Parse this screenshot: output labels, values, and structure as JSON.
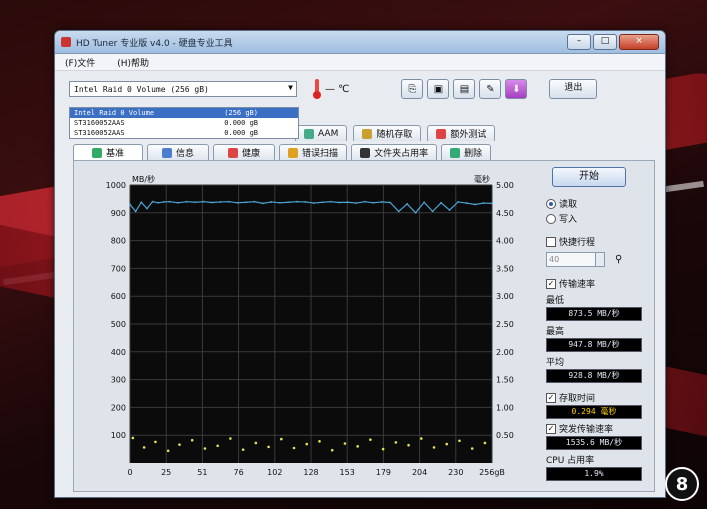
{
  "window": {
    "title": "HD Tuner 专业版 v4.0 - 硬盘专业工具",
    "minimize": "–",
    "maximize": "□",
    "close": "×"
  },
  "menu": {
    "file": "(F)文件",
    "help": "(H)帮助"
  },
  "toolbar": {
    "drive_selected": "Intel  Raid 0 Volume (256 gB)",
    "temp_reading": "— ℃",
    "exit_label": "退出"
  },
  "dropdown": {
    "options": [
      {
        "name": "Intel  Raid 0 Volume",
        "capacity": "(256 gB)"
      },
      {
        "name": "ST3160052AAS",
        "capacity": "0.000 gB"
      },
      {
        "name": "ST3160052AAS",
        "capacity": "0.000 gB"
      }
    ]
  },
  "tabs_upper": [
    {
      "label": "AAM",
      "icon": "speaker-icon"
    },
    {
      "label": "随机存取",
      "icon": "random-access-icon"
    },
    {
      "label": "额外测试",
      "icon": "extra-test-icon"
    }
  ],
  "tabs_lower": [
    {
      "label": "基准",
      "icon": "benchmark-icon"
    },
    {
      "label": "信息",
      "icon": "info-icon"
    },
    {
      "label": "健康",
      "icon": "health-icon"
    },
    {
      "label": "错误扫描",
      "icon": "error-scan-icon"
    },
    {
      "label": "文件夹占用率",
      "icon": "folder-usage-icon"
    },
    {
      "label": "删除",
      "icon": "erase-icon"
    }
  ],
  "panel": {
    "start": "开始",
    "read": "读取",
    "write": "写入",
    "shortstroke": "快捷行程",
    "shortstroke_value": "40",
    "transfer_rate": "传输速率",
    "min_label": "最低",
    "min_value": "873.5 MB/秒",
    "max_label": "最高",
    "max_value": "947.8 MB/秒",
    "avg_label": "平均",
    "avg_value": "928.8 MB/秒",
    "access_time": "存取时间",
    "access_value": "0.294 毫秒",
    "burst_rate": "突发传输速率",
    "burst_value": "1535.6 MB/秒",
    "cpu_label": "CPU 占用率",
    "cpu_value": "1.9%"
  },
  "colors": {
    "chart_bg": "#0b0b0b",
    "grid": "#3a3a3a",
    "transfer_line": "#4aa6d6",
    "access_points": "#e6e05a"
  },
  "chart_data": {
    "type": "line",
    "ylabel_left": "MB/秒",
    "ylabel_right": "毫秒",
    "y_left_ticks": [
      "1000",
      "900",
      "800",
      "700",
      "600",
      "500",
      "400",
      "300",
      "200",
      "100"
    ],
    "y_right_ticks": [
      "5.00",
      "4.50",
      "4.00",
      "3.50",
      "3.00",
      "2.50",
      "2.00",
      "1.50",
      "1.00",
      "0.50"
    ],
    "x_ticks": [
      "0",
      "25",
      "51",
      "76",
      "102",
      "128",
      "153",
      "179",
      "204",
      "230",
      "256gB"
    ],
    "ylim": [
      0,
      1000
    ],
    "xlim": [
      0,
      256
    ],
    "y2lim": [
      0,
      5
    ],
    "series": [
      {
        "x": [
          0,
          4,
          8,
          12,
          16,
          20,
          24,
          28,
          34,
          40,
          46,
          52,
          58,
          64,
          70,
          76,
          82,
          88,
          94,
          100,
          106,
          112,
          118,
          124,
          130,
          136,
          142,
          148,
          154,
          160,
          166,
          172,
          178,
          184,
          190,
          196,
          202,
          208,
          214,
          220,
          226,
          232,
          238,
          244,
          250,
          256
        ],
        "values": [
          930,
          905,
          938,
          915,
          940,
          936,
          939,
          940,
          936,
          940,
          938,
          940,
          937,
          939,
          940,
          936,
          938,
          940,
          934,
          939,
          936,
          938,
          940,
          939,
          935,
          938,
          940,
          937,
          938,
          935,
          940,
          936,
          939,
          937,
          905,
          932,
          900,
          938,
          905,
          936,
          910,
          939,
          935,
          930,
          935,
          934
        ]
      },
      {
        "x": [
          2,
          10,
          18,
          27,
          35,
          44,
          53,
          62,
          71,
          80,
          89,
          98,
          107,
          116,
          125,
          134,
          143,
          152,
          161,
          170,
          179,
          188,
          197,
          206,
          215,
          224,
          233,
          242,
          251
        ],
        "values": [
          0.45,
          0.28,
          0.38,
          0.22,
          0.33,
          0.41,
          0.26,
          0.31,
          0.44,
          0.24,
          0.36,
          0.29,
          0.43,
          0.27,
          0.34,
          0.39,
          0.23,
          0.35,
          0.3,
          0.42,
          0.25,
          0.37,
          0.32,
          0.44,
          0.28,
          0.34,
          0.4,
          0.26,
          0.36
        ]
      }
    ]
  }
}
